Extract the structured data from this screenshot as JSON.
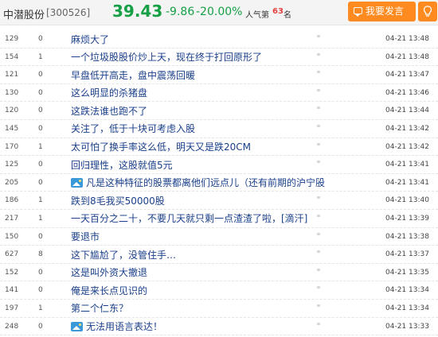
{
  "header": {
    "stock_name": "中潜股份",
    "stock_code": "[300526]",
    "price": "39.43",
    "change": "-9.86",
    "change_pct": "-20.00%",
    "popularity_label": "人气第",
    "popularity_rank": "63",
    "popularity_unit": "名",
    "post_button_label": "我要发言",
    "accent_color": "#ff8a1f",
    "down_color": "#16a045"
  },
  "posts": [
    {
      "read": "129",
      "reply": "0",
      "title": "麻烦大了",
      "has_pic": false,
      "time": "04-21  13:48"
    },
    {
      "read": "154",
      "reply": "1",
      "title": "一个垃圾股股价炒上天，现在终于打回原形了",
      "has_pic": false,
      "time": "04-21  13:48"
    },
    {
      "read": "121",
      "reply": "0",
      "title": "早盘低开高走，盘中震荡回暖",
      "has_pic": false,
      "time": "04-21  13:47"
    },
    {
      "read": "130",
      "reply": "0",
      "title": "这么明显的杀猪盘",
      "has_pic": false,
      "time": "04-21  13:46"
    },
    {
      "read": "120",
      "reply": "0",
      "title": "这跌法谁也跑不了",
      "has_pic": false,
      "time": "04-21  13:44"
    },
    {
      "read": "145",
      "reply": "0",
      "title": "关注了，低于十块可考虑入股",
      "has_pic": false,
      "time": "04-21  13:42"
    },
    {
      "read": "170",
      "reply": "1",
      "title": "太可怕了换手率这么低，明天又是跌20CM",
      "has_pic": false,
      "time": "04-21  13:42"
    },
    {
      "read": "125",
      "reply": "0",
      "title": "回归理性，这股就值5元",
      "has_pic": false,
      "time": "04-21  13:41"
    },
    {
      "read": "205",
      "reply": "0",
      "title": "凡是这种特征的股票都离他们远点儿（还有前期的沪宁股",
      "has_pic": true,
      "time": "04-21  13:41"
    },
    {
      "read": "186",
      "reply": "1",
      "title": "跌到8毛我买50000股",
      "has_pic": false,
      "time": "04-21  13:40"
    },
    {
      "read": "217",
      "reply": "1",
      "title": "一天百分之二十，不要几天就只剩一点渣渣了啦，[滴汗]",
      "has_pic": false,
      "time": "04-21  13:39"
    },
    {
      "read": "150",
      "reply": "0",
      "title": "要退市",
      "has_pic": false,
      "time": "04-21  13:38"
    },
    {
      "read": "627",
      "reply": "8",
      "title": "这下尴尬了，没管住手…",
      "has_pic": false,
      "time": "04-21  13:37"
    },
    {
      "read": "152",
      "reply": "0",
      "title": "这是叫外资大撤退",
      "has_pic": false,
      "time": "04-21  13:35"
    },
    {
      "read": "141",
      "reply": "0",
      "title": "俺是来长点见识的",
      "has_pic": false,
      "time": "04-21  13:34"
    },
    {
      "read": "197",
      "reply": "1",
      "title": "第二个仁东？",
      "has_pic": false,
      "time": "04-21  13:34"
    },
    {
      "read": "248",
      "reply": "0",
      "title": "无法用语言表达！",
      "has_pic": true,
      "time": "04-21  13:33"
    }
  ]
}
